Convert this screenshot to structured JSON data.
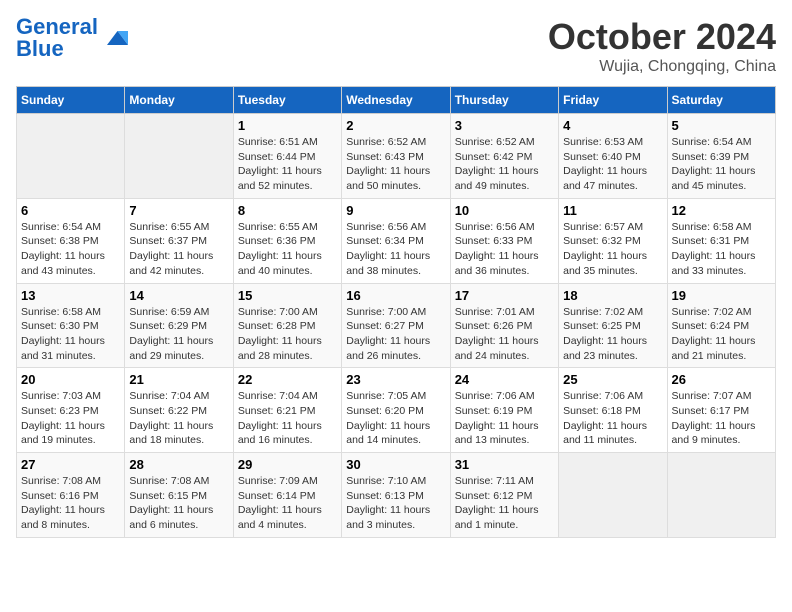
{
  "header": {
    "logo_general": "General",
    "logo_blue": "Blue",
    "month_title": "October 2024",
    "location": "Wujia, Chongqing, China"
  },
  "weekdays": [
    "Sunday",
    "Monday",
    "Tuesday",
    "Wednesday",
    "Thursday",
    "Friday",
    "Saturday"
  ],
  "weeks": [
    [
      {
        "day": "",
        "info": ""
      },
      {
        "day": "",
        "info": ""
      },
      {
        "day": "1",
        "info": "Sunrise: 6:51 AM\nSunset: 6:44 PM\nDaylight: 11 hours and 52 minutes."
      },
      {
        "day": "2",
        "info": "Sunrise: 6:52 AM\nSunset: 6:43 PM\nDaylight: 11 hours and 50 minutes."
      },
      {
        "day": "3",
        "info": "Sunrise: 6:52 AM\nSunset: 6:42 PM\nDaylight: 11 hours and 49 minutes."
      },
      {
        "day": "4",
        "info": "Sunrise: 6:53 AM\nSunset: 6:40 PM\nDaylight: 11 hours and 47 minutes."
      },
      {
        "day": "5",
        "info": "Sunrise: 6:54 AM\nSunset: 6:39 PM\nDaylight: 11 hours and 45 minutes."
      }
    ],
    [
      {
        "day": "6",
        "info": "Sunrise: 6:54 AM\nSunset: 6:38 PM\nDaylight: 11 hours and 43 minutes."
      },
      {
        "day": "7",
        "info": "Sunrise: 6:55 AM\nSunset: 6:37 PM\nDaylight: 11 hours and 42 minutes."
      },
      {
        "day": "8",
        "info": "Sunrise: 6:55 AM\nSunset: 6:36 PM\nDaylight: 11 hours and 40 minutes."
      },
      {
        "day": "9",
        "info": "Sunrise: 6:56 AM\nSunset: 6:34 PM\nDaylight: 11 hours and 38 minutes."
      },
      {
        "day": "10",
        "info": "Sunrise: 6:56 AM\nSunset: 6:33 PM\nDaylight: 11 hours and 36 minutes."
      },
      {
        "day": "11",
        "info": "Sunrise: 6:57 AM\nSunset: 6:32 PM\nDaylight: 11 hours and 35 minutes."
      },
      {
        "day": "12",
        "info": "Sunrise: 6:58 AM\nSunset: 6:31 PM\nDaylight: 11 hours and 33 minutes."
      }
    ],
    [
      {
        "day": "13",
        "info": "Sunrise: 6:58 AM\nSunset: 6:30 PM\nDaylight: 11 hours and 31 minutes."
      },
      {
        "day": "14",
        "info": "Sunrise: 6:59 AM\nSunset: 6:29 PM\nDaylight: 11 hours and 29 minutes."
      },
      {
        "day": "15",
        "info": "Sunrise: 7:00 AM\nSunset: 6:28 PM\nDaylight: 11 hours and 28 minutes."
      },
      {
        "day": "16",
        "info": "Sunrise: 7:00 AM\nSunset: 6:27 PM\nDaylight: 11 hours and 26 minutes."
      },
      {
        "day": "17",
        "info": "Sunrise: 7:01 AM\nSunset: 6:26 PM\nDaylight: 11 hours and 24 minutes."
      },
      {
        "day": "18",
        "info": "Sunrise: 7:02 AM\nSunset: 6:25 PM\nDaylight: 11 hours and 23 minutes."
      },
      {
        "day": "19",
        "info": "Sunrise: 7:02 AM\nSunset: 6:24 PM\nDaylight: 11 hours and 21 minutes."
      }
    ],
    [
      {
        "day": "20",
        "info": "Sunrise: 7:03 AM\nSunset: 6:23 PM\nDaylight: 11 hours and 19 minutes."
      },
      {
        "day": "21",
        "info": "Sunrise: 7:04 AM\nSunset: 6:22 PM\nDaylight: 11 hours and 18 minutes."
      },
      {
        "day": "22",
        "info": "Sunrise: 7:04 AM\nSunset: 6:21 PM\nDaylight: 11 hours and 16 minutes."
      },
      {
        "day": "23",
        "info": "Sunrise: 7:05 AM\nSunset: 6:20 PM\nDaylight: 11 hours and 14 minutes."
      },
      {
        "day": "24",
        "info": "Sunrise: 7:06 AM\nSunset: 6:19 PM\nDaylight: 11 hours and 13 minutes."
      },
      {
        "day": "25",
        "info": "Sunrise: 7:06 AM\nSunset: 6:18 PM\nDaylight: 11 hours and 11 minutes."
      },
      {
        "day": "26",
        "info": "Sunrise: 7:07 AM\nSunset: 6:17 PM\nDaylight: 11 hours and 9 minutes."
      }
    ],
    [
      {
        "day": "27",
        "info": "Sunrise: 7:08 AM\nSunset: 6:16 PM\nDaylight: 11 hours and 8 minutes."
      },
      {
        "day": "28",
        "info": "Sunrise: 7:08 AM\nSunset: 6:15 PM\nDaylight: 11 hours and 6 minutes."
      },
      {
        "day": "29",
        "info": "Sunrise: 7:09 AM\nSunset: 6:14 PM\nDaylight: 11 hours and 4 minutes."
      },
      {
        "day": "30",
        "info": "Sunrise: 7:10 AM\nSunset: 6:13 PM\nDaylight: 11 hours and 3 minutes."
      },
      {
        "day": "31",
        "info": "Sunrise: 7:11 AM\nSunset: 6:12 PM\nDaylight: 11 hours and 1 minute."
      },
      {
        "day": "",
        "info": ""
      },
      {
        "day": "",
        "info": ""
      }
    ]
  ]
}
